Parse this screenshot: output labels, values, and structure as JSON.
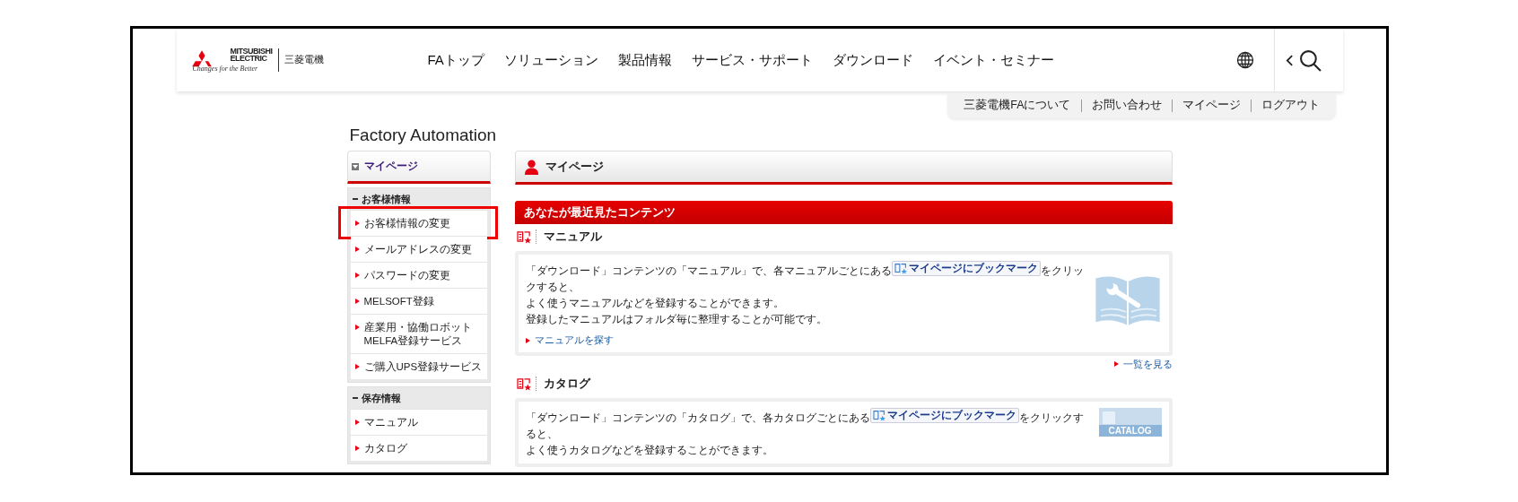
{
  "header": {
    "logo": {
      "brand_line_1": "MITSUBISHI",
      "brand_line_2": "ELECTRIC",
      "tagline": "Changes for the Better",
      "name_ja": "三菱電機"
    },
    "nav": [
      "FAトップ",
      "ソリューション",
      "製品情報",
      "サービス・サポート",
      "ダウンロード",
      "イベント・セミナー"
    ],
    "utility_links": [
      "三菱電機FAについて",
      "お問い合わせ",
      "マイページ",
      "ログアウト"
    ]
  },
  "site_title": "Factory Automation",
  "sidebar": {
    "title": "マイページ",
    "sections": [
      {
        "heading": "お客様情報",
        "items": [
          {
            "label": "お客様情報の変更",
            "highlighted": true
          },
          {
            "label": "メールアドレスの変更",
            "highlighted": false
          },
          {
            "label": "パスワードの変更",
            "highlighted": false
          },
          {
            "label": "MELSOFT登録",
            "highlighted": false
          },
          {
            "label": "産業用・協働ロボット\nMELFA登録サービス",
            "highlighted": false
          },
          {
            "label": "ご購入UPS登録サービス",
            "highlighted": false
          }
        ]
      },
      {
        "heading": "保存情報",
        "items": [
          {
            "label": "マニュアル",
            "highlighted": false
          },
          {
            "label": "カタログ",
            "highlighted": false
          }
        ]
      }
    ]
  },
  "main": {
    "page_title": "マイページ",
    "section_banner": "あなたが最近見たコンテンツ",
    "groups": [
      {
        "kind": "manual",
        "title": "マニュアル",
        "before": "「ダウンロード」コンテンツの「マニュアル」で、各マニュアルごとにある",
        "button": "マイページにブックマーク",
        "after": "をクリックすると、",
        "continuation": "よく使うマニュアルなどを登録することができます。",
        "note": "登録したマニュアルはフォルダ毎に整理することが可能です。",
        "link": "マニュアルを探す",
        "more_link": "一覧を見る"
      },
      {
        "kind": "catalog",
        "title": "カタログ",
        "before": "「ダウンロード」コンテンツの「カタログ」で、各カタログごとにある",
        "button": "マイページにブックマーク",
        "after": "をクリックすると、",
        "continuation": "よく使うカタログなどを登録することができます。",
        "illustration_label": "CATALOG"
      }
    ]
  }
}
